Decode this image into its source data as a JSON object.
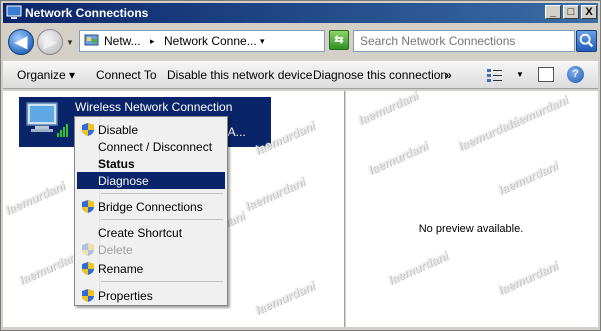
{
  "window": {
    "title": "Network Connections"
  },
  "titlebar_buttons": {
    "minimize": "_",
    "maximize": "□",
    "close": "X"
  },
  "address": {
    "crumbs": [
      "Netw...",
      "▸",
      "Network Conne...",
      "▾"
    ],
    "search_placeholder": "Search Network Connections"
  },
  "toolbar": {
    "organize": "Organize ▾",
    "connect_to": "Connect To",
    "disable_device": "Disable this network device",
    "diagnose": "Diagnose this connection",
    "more": "»",
    "help": "?"
  },
  "connection": {
    "name": "Wireless Network Connection",
    "line2_suffix": "rk A..."
  },
  "context_menu": {
    "items": [
      {
        "label": "Disable",
        "shield": true
      },
      {
        "label": "Connect / Disconnect"
      },
      {
        "label": "Status",
        "bold": true
      },
      {
        "label": "Diagnose",
        "selected": true
      },
      {
        "label": "Bridge Connections",
        "shield": true
      },
      {
        "label": "Create Shortcut"
      },
      {
        "label": "Delete",
        "disabled": true,
        "shield": true
      },
      {
        "label": "Rename",
        "shield": true
      },
      {
        "label": "Properties",
        "shield": true
      }
    ]
  },
  "preview": {
    "text": "No preview available."
  },
  "watermark": {
    "text": "laemurdani"
  },
  "colors": {
    "selection": "#0a246a",
    "title_gradient_start": "#0a246a",
    "title_gradient_end": "#3a6ea5"
  }
}
